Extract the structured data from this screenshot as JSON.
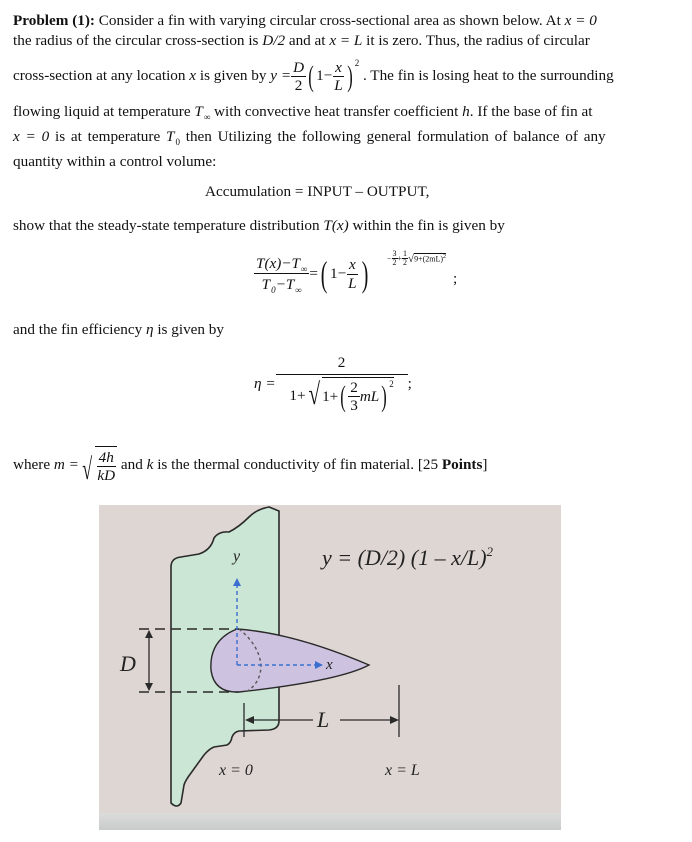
{
  "problem": {
    "heading": "Problem (1):",
    "line1": "Consider a fin with varying circular cross-sectional area as shown below.  At",
    "line1_eq": "x = 0",
    "line2_a": "the radius of the circular cross-section is",
    "line2_D2": "D/2",
    "line2_b": "and at",
    "line2_xL": "x = L",
    "line2_c": "it is zero. Thus, the radius of circular",
    "line3_a": "cross-section at any location",
    "line3_x": "x",
    "line3_b": "is given by",
    "line3_c": ". The fin is losing heat to the surrounding",
    "line4_a": "flowing liquid at temperature",
    "line4_b": "with convective heat transfer coefficient",
    "line4_h": "h",
    "line4_c": ". If the base of fin at",
    "line5_x0": "x = 0",
    "line5_a": "is at temperature",
    "line5_b": "then Utilizing the following general formulation of balance of any",
    "line6": "quantity within a control volume:",
    "balance": "Accumulation = INPUT – OUTPUT,",
    "line7_a": "show that the steady-state temperature distribution",
    "line7_T": "T(x)",
    "line7_b": "within the fin is given by",
    "line8_a": "and the fin efficiency",
    "line8_eta": "η",
    "line8_b": "is given by",
    "line9_a": "where",
    "line9_m": "m =",
    "line9_b": "and",
    "line9_k": "k",
    "line9_c": "is the thermal conductivity of fin material. [25",
    "line9_points": "Points",
    "line9_d": "]"
  },
  "equations": {
    "radius": {
      "lhs": "y =",
      "num": "D",
      "den": "2",
      "one_minus": "1−",
      "x": "x",
      "L": "L",
      "exp": "2"
    },
    "temperature": {
      "num": "T(x)−T",
      "inf": "∞",
      "den_T": "T",
      "den_0": "0",
      "den_mid": "−T",
      "eq": "=",
      "one_minus": "1−",
      "x": "x",
      "L": "L",
      "exp": "−¾+½√9+(2mL)²",
      "exp_a": "−",
      "exp_3": "3",
      "exp_2": "2",
      "exp_plus": "+",
      "exp_1": "1",
      "exp_rad": "9+(2mL)",
      "exp_sq": "2",
      "semicolon": ";"
    },
    "efficiency": {
      "eta": "η =",
      "num": "2",
      "den_a": "1+",
      "den_b": "1+",
      "frac_num": "2",
      "frac_den": "3",
      "mL": "mL",
      "sq": "2",
      "semicolon": ";"
    },
    "m_def": {
      "num": "4h",
      "den": "kD"
    },
    "T_inf": "T",
    "T_inf_sub": "∞",
    "T0": "T",
    "T0_sub": "0"
  },
  "figure": {
    "colors": {
      "background": "#ded6d3",
      "wall": "#cbe6d4",
      "fin": "#cdc3e0",
      "axis": "#3a6fd0",
      "line": "#2a2a2a",
      "shadow": "#d4d4d4"
    },
    "formula": "y = (D/2) (1 – x/L)",
    "formula_exp": "2",
    "label_y": "y",
    "label_x": "x",
    "label_D": "D",
    "label_L": "L",
    "label_x0": "x = 0",
    "label_xL": "x = L"
  }
}
